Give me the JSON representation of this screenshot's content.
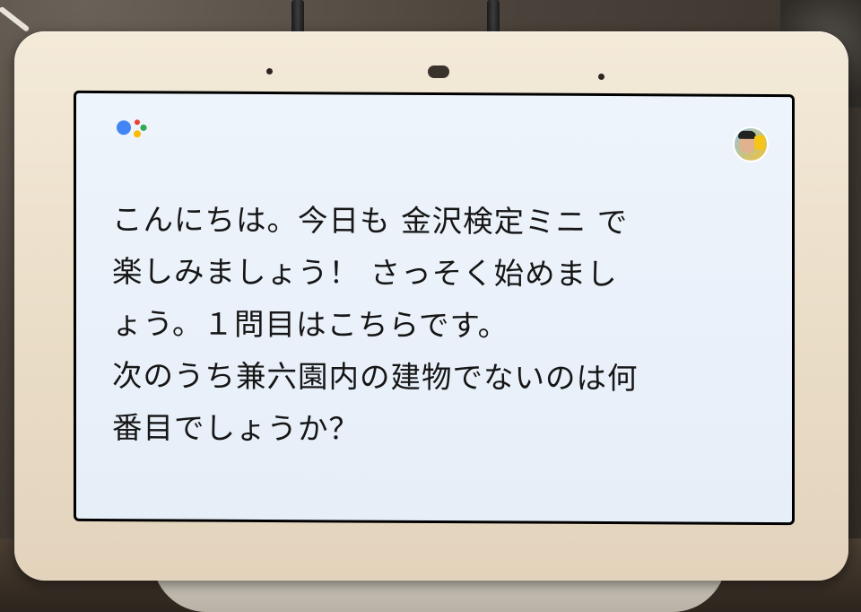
{
  "assistant": {
    "logo_icon": "google-assistant-icon",
    "dot_colors": [
      "#4285F4",
      "#EA4335",
      "#FBBC05",
      "#34A853"
    ]
  },
  "user": {
    "avatar_icon": "user-avatar-icon"
  },
  "message": {
    "text": "こんにちは。今日も 金沢検定ミニ で\n楽しみましょう！ さっそく始めまし\nょう。１問目はこちらです。\n次のうち兼六園内の建物でないのは何\n番目でしょうか？"
  }
}
